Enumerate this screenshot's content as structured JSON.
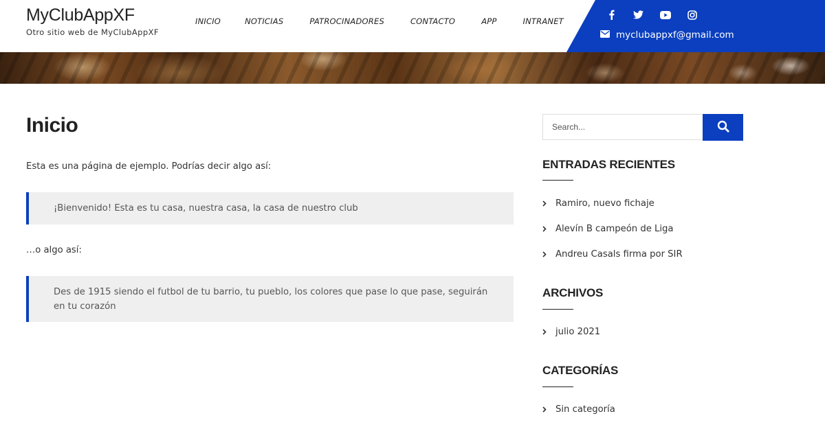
{
  "site": {
    "title": "MyClubAppXF",
    "tagline": "Otro sitio web de MyClubAppXF"
  },
  "nav": {
    "items": [
      {
        "label": "INICIO"
      },
      {
        "label": "NOTICIAS"
      },
      {
        "label": "PATROCINADORES"
      },
      {
        "label": "CONTACTO"
      },
      {
        "label": "APP"
      },
      {
        "label": "INTRANET"
      }
    ]
  },
  "topbar": {
    "social_icons": [
      "facebook-icon",
      "twitter-icon",
      "youtube-icon",
      "instagram-icon"
    ],
    "email": "myclubappxf@gmail.com",
    "accent_color": "#0b3fbf"
  },
  "main": {
    "title": "Inicio",
    "paragraph_1": "Esta es una página de ejemplo. Podrías decir algo así:",
    "quote_1": "¡Bienvenido! Esta es tu casa, nuestra casa, la casa de nuestro club",
    "paragraph_2": "…o algo así:",
    "quote_2": "Des de 1915 siendo el futbol de tu barrio, tu pueblo, los colores que pase lo que pase, seguirán en tu corazón"
  },
  "sidebar": {
    "search": {
      "placeholder": "Search..."
    },
    "recent": {
      "title": "ENTRADAS RECIENTES",
      "items": [
        "Ramiro, nuevo fichaje",
        "Alevín B campeón de Liga",
        "Andreu Casals firma por SIR"
      ]
    },
    "archives": {
      "title": "ARCHIVOS",
      "items": [
        "julio 2021"
      ]
    },
    "categories": {
      "title": "CATEGORÍAS",
      "items": [
        "Sin categoría"
      ]
    }
  }
}
